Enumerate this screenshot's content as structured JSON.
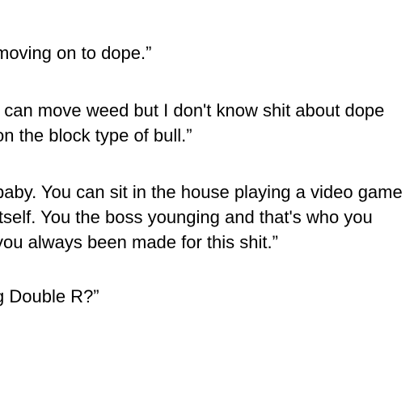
{
  "document": {
    "lines": [
      "moving on to dope.”",
      "I can move weed but I don't know shit about dope",
      "on the block type of bull.”",
      "baby. You can sit in the house playing a video game",
      "itself. You the boss younging and that's who you",
      "you always been made for this shit.”",
      "g Double R?”"
    ]
  }
}
